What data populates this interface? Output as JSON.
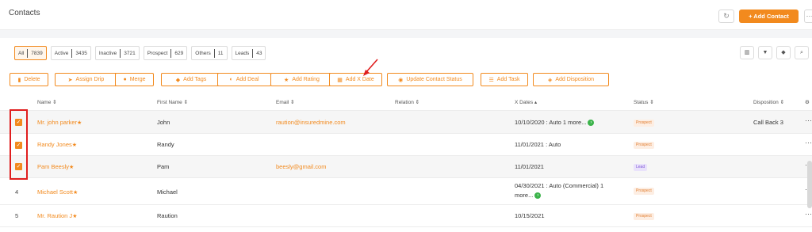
{
  "page": {
    "title": "Contacts"
  },
  "header": {
    "refresh_icon": "↻",
    "add_contact": "+ Add Contact",
    "more_icon": "⋯"
  },
  "filters": [
    {
      "label": "All",
      "count": "7839",
      "active": true
    },
    {
      "label": "Active",
      "count": "3435",
      "active": false
    },
    {
      "label": "Inactive",
      "count": "3721",
      "active": false
    },
    {
      "label": "Prospect",
      "count": "629",
      "active": false
    },
    {
      "label": "Others",
      "count": "11",
      "active": false
    },
    {
      "label": "Leads",
      "count": "43",
      "active": false
    }
  ],
  "tools": {
    "columns_icon": "▥",
    "filter_icon": "▼",
    "tag_icon": "◆",
    "search_icon": "⌕"
  },
  "actions": [
    {
      "label": "Delete",
      "icon": "trash-icon",
      "glyph": "▮"
    },
    {
      "label": "Assign Drip",
      "icon": "send-icon",
      "glyph": "➤"
    },
    {
      "label": "Merge",
      "icon": "users-icon",
      "glyph": "●"
    },
    {
      "label": "Add Tags",
      "icon": "tag-icon",
      "glyph": "◆"
    },
    {
      "label": "Add Deal",
      "icon": "handshake-icon",
      "glyph": "◐"
    },
    {
      "label": "Add Rating",
      "icon": "star-icon",
      "glyph": "★"
    },
    {
      "label": "Add X Date",
      "icon": "calendar-icon",
      "glyph": "▦"
    },
    {
      "label": "Update Contact Status",
      "icon": "user-update-icon",
      "glyph": "◉"
    },
    {
      "label": "Add Task",
      "icon": "list-icon",
      "glyph": "☰"
    },
    {
      "label": "Add Disposition",
      "icon": "layers-icon",
      "glyph": "◈"
    }
  ],
  "columns": {
    "name": "Name ⇕",
    "first_name": "First Name ⇕",
    "email": "Email ⇕",
    "relation": "Relation ⇕",
    "x_dates": "X Dates ▴",
    "status": "Status ⇕",
    "disposition": "Disposition ⇕",
    "settings_icon": "⚙"
  },
  "rows": [
    {
      "index": "",
      "checked": true,
      "name": "Mr. john parker",
      "first_name": "John",
      "email": "raution@insuredmine.com",
      "x_dates": "10/10/2020 : Auto 1 more...",
      "x_dates_line2": "",
      "more": true,
      "status": "Prospect",
      "disposition": "Call Back 3"
    },
    {
      "index": "",
      "checked": true,
      "name": "Randy Jones",
      "first_name": "Randy",
      "email": "",
      "x_dates": "11/01/2021 : Auto",
      "x_dates_line2": "",
      "more": false,
      "status": "Prospect",
      "disposition": ""
    },
    {
      "index": "",
      "checked": true,
      "name": "Pam Beesly",
      "first_name": "Pam",
      "email": "beesly@gmail.com",
      "x_dates": "11/01/2021",
      "x_dates_line2": "",
      "more": false,
      "status": "Lead",
      "disposition": ""
    },
    {
      "index": "4",
      "checked": false,
      "name": "Michael Scott",
      "first_name": "Michael",
      "email": "",
      "x_dates": "04/30/2021 : Auto (Commercial) 1",
      "x_dates_line2": "more...",
      "more": true,
      "status": "Prospect",
      "disposition": ""
    },
    {
      "index": "5",
      "checked": false,
      "name": "Mr. Raution J",
      "first_name": "Raution",
      "email": "",
      "x_dates": "10/15/2021",
      "x_dates_line2": "",
      "more": false,
      "status": "Prospect",
      "disposition": ""
    }
  ],
  "row_menu": "⋯",
  "star": "★",
  "checkmark": "✓",
  "more_arrow": "›",
  "colors": {
    "accent": "#f28a1e",
    "annotation": "#e01e1e",
    "lead": "#8058d7",
    "more_badge": "#3bb34a"
  }
}
